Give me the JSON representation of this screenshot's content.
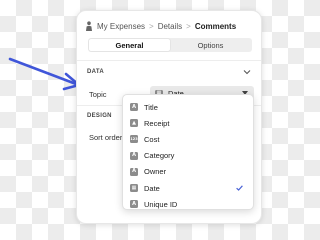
{
  "breadcrumb": {
    "items": [
      "My Expenses",
      "Details"
    ],
    "current": "Comments",
    "separator": ">"
  },
  "tabs": [
    {
      "label": "General",
      "active": true
    },
    {
      "label": "Options",
      "active": false
    }
  ],
  "sections": {
    "data": {
      "header": "DATA"
    },
    "design": {
      "header": "DESIGN"
    }
  },
  "fields": {
    "topic": {
      "label": "Topic",
      "value": "Date"
    },
    "sort_order": {
      "label": "Sort order"
    }
  },
  "dropdown": {
    "options": [
      {
        "label": "Title",
        "icon": "text-field-icon",
        "glyph": "A"
      },
      {
        "label": "Receipt",
        "icon": "image-field-icon",
        "glyph": "▲"
      },
      {
        "label": "Cost",
        "icon": "number-field-icon",
        "glyph": "123"
      },
      {
        "label": "Category",
        "icon": "text-field-icon",
        "glyph": "A"
      },
      {
        "label": "Owner",
        "icon": "text-field-icon",
        "glyph": "A"
      },
      {
        "label": "Date",
        "icon": "date-field-icon",
        "glyph": "▦",
        "selected": true
      },
      {
        "label": "Unique ID",
        "icon": "text-field-icon",
        "glyph": "A"
      }
    ]
  },
  "colors": {
    "accent": "#4a63d6",
    "arrow": "#4056d9",
    "icon": "#8c8c8c"
  }
}
